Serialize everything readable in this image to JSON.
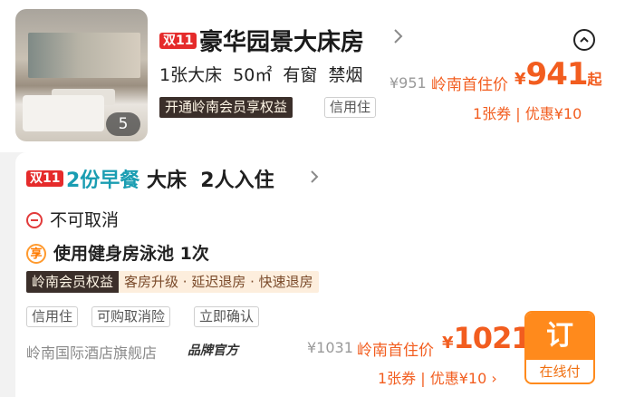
{
  "room": {
    "photo_count": "5",
    "promo_tag": "双11",
    "title": "豪华园景大床房",
    "specs": "1张大床  50㎡  有窗  禁烟",
    "member_bar": "开通岭南会员享权益",
    "credit_tag": "信用住",
    "original_price": "¥951",
    "first_stay_label": "岭南首住价",
    "currency": "¥",
    "price": "941",
    "price_suffix": "起",
    "coupon_text": "1张券 | 优惠¥10"
  },
  "plan": {
    "promo_tag": "双11",
    "breakfast": "2份早餐",
    "details": " 大床  2人入住",
    "cancel_policy": "不可取消",
    "enjoy_icon": "享",
    "perk": "使用健身房泳池 1次",
    "member_benefit_label": "岭南会员权益",
    "member_benefit_items": "客房升级 · 延迟退房 · 快速退房",
    "tags": [
      "信用住",
      "可购取消险",
      "立即确认"
    ],
    "store_name": "岭南国际酒店旗舰店",
    "brand_badge": "品牌官方",
    "original_price": "¥1031",
    "first_stay_label": "岭南首住价",
    "currency": "¥",
    "price": "1021",
    "coupon_text": "1张券 | 优惠¥10 ›",
    "book_label": "订",
    "pay_label": "在线付"
  },
  "colors": {
    "accent_orange": "#f25d1f",
    "promo_red": "#e52b2b",
    "teal": "#1a9db2",
    "member_dark": "#3b2f2a"
  }
}
